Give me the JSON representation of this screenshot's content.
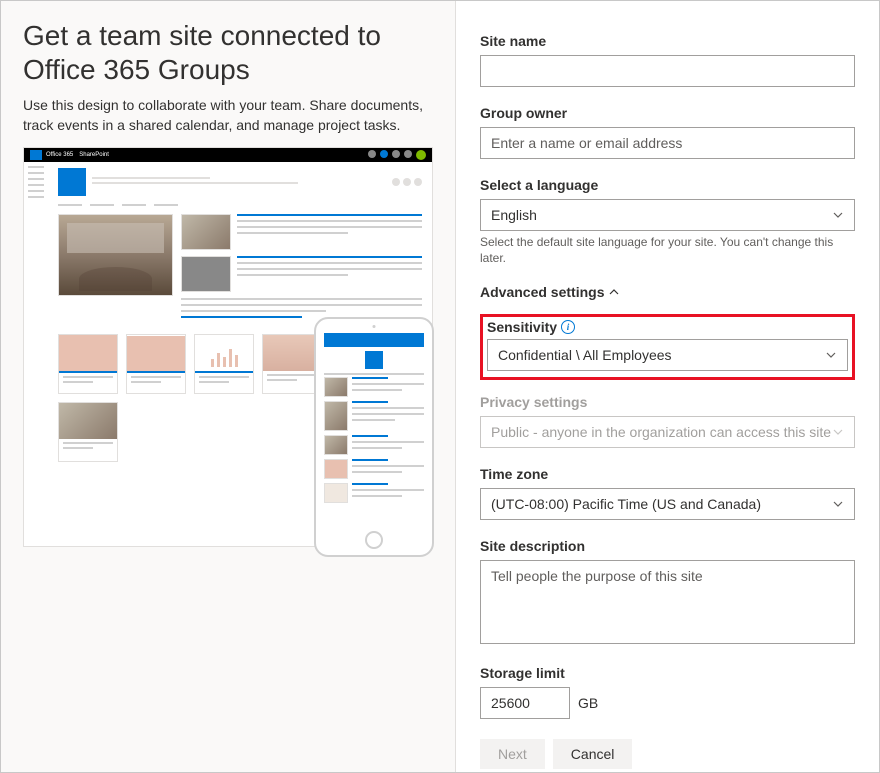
{
  "left": {
    "title": "Get a team site connected to Office 365 Groups",
    "description": "Use this design to collaborate with your team. Share documents, track events in a shared calendar, and manage project tasks."
  },
  "preview": {
    "topbar_office": "Office 365",
    "topbar_sharepoint": "SharePoint"
  },
  "form": {
    "site_name_label": "Site name",
    "site_name_value": "",
    "group_owner_label": "Group owner",
    "group_owner_placeholder": "Enter a name or email address",
    "language_label": "Select a language",
    "language_value": "English",
    "language_helper": "Select the default site language for your site. You can't change this later.",
    "advanced_label": "Advanced settings",
    "sensitivity_label": "Sensitivity",
    "sensitivity_value": "Confidential \\ All Employees",
    "privacy_label": "Privacy settings",
    "privacy_value": "Public - anyone in the organization can access this site",
    "timezone_label": "Time zone",
    "timezone_value": "(UTC-08:00) Pacific Time (US and Canada)",
    "description_label": "Site description",
    "description_placeholder": "Tell people the purpose of this site",
    "storage_label": "Storage limit",
    "storage_value": "25600",
    "storage_unit": "GB",
    "next_label": "Next",
    "cancel_label": "Cancel"
  }
}
